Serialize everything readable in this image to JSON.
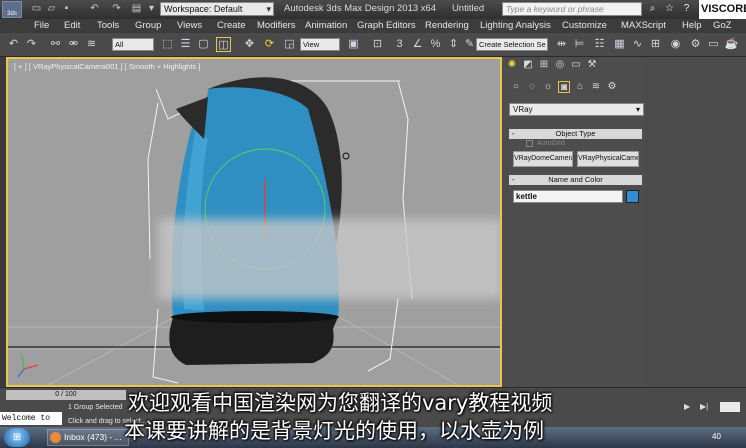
{
  "title_bar": {
    "logo_text": "3ds",
    "workspace_label": "Workspace: Default",
    "app_title": "Autodesk 3ds Max Design 2013 x64",
    "doc_title": "Untitled",
    "search_placeholder": "Type a keyword or phrase",
    "channel_watermark": "VISCORB"
  },
  "menu": {
    "items": [
      "File",
      "Edit",
      "Tools",
      "Group",
      "Views",
      "Create",
      "Modifiers",
      "Animation",
      "Graph Editors",
      "Rendering",
      "Lighting Analysis",
      "Customize",
      "MAXScript",
      "Help",
      "GoZ"
    ]
  },
  "toolbar": {
    "filter_select": "All",
    "ref_coord_select": "View",
    "selection_set_placeholder": "Create Selection Se"
  },
  "viewport": {
    "label": "[ + ] [ VRayPhysicalCamera001 ] [ Smooth + Highlights ]",
    "object_color": "#2f8fc2"
  },
  "command_panel": {
    "category_select": "VRay",
    "object_type_rollout": "Object Type",
    "autogrid_label": "AutoGrid",
    "buttons": [
      "VRayDomeCamera",
      "VRayPhysicalCamera"
    ],
    "name_color_rollout": "Name and Color",
    "object_name": "kettle",
    "object_color": "#2f8fd2"
  },
  "status": {
    "time_slider": "0 / 100",
    "selection_info": "1 Group Selected",
    "hint": "Click and drag to select...",
    "maxscript_prompt": "Welcome to"
  },
  "subtitles": {
    "line1": "欢迎观看中国渲染网为您翻译的vary教程视频",
    "line2": "本课要讲解的是背景灯光的使用，以水壶为例"
  },
  "taskbar": {
    "app_label": "Inbox (473) - ...",
    "clock_fragment": "40"
  },
  "colors": {
    "viewport_border": "#e5c74a",
    "viewport_bg": "#9f9f9f",
    "kettle_blue": "#2f8fc2"
  }
}
